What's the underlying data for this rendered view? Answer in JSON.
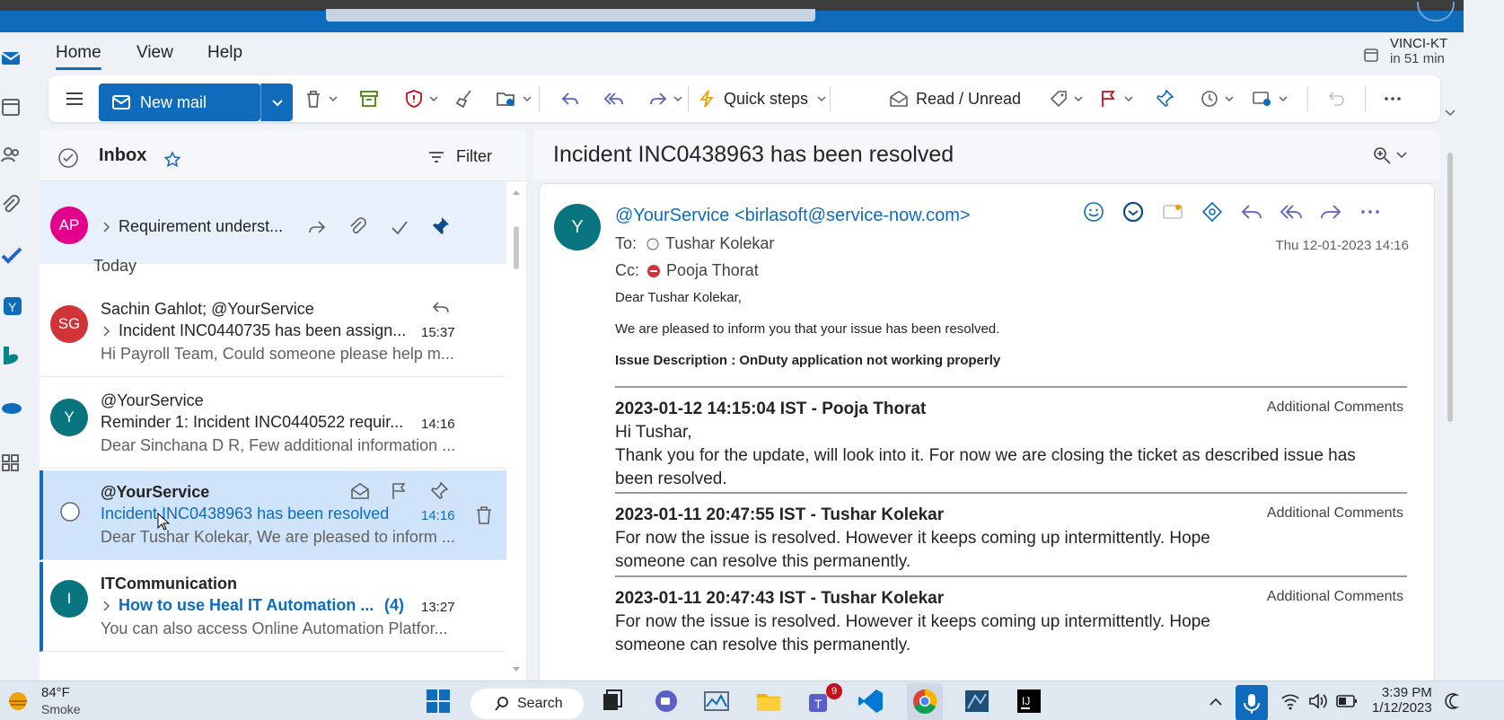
{
  "ribbon": {
    "tabs": [
      "Home",
      "View",
      "Help"
    ],
    "reminder_title": "VINCI-KT",
    "reminder_time": "in 51 min"
  },
  "toolbar": {
    "new_mail": "New mail",
    "quick_steps": "Quick steps",
    "read_unread": "Read / Unread"
  },
  "list": {
    "folder": "Inbox",
    "filter": "Filter",
    "group_today": "Today",
    "pinned": {
      "initials": "AP",
      "subject": "Requirement underst...",
      "avatar_color": "#e3008c"
    },
    "messages": [
      {
        "initials": "SG",
        "sender": "Sachin Gahlot; @YourService",
        "subject": "Incident INC0440735 has been assign...",
        "preview": "Hi Payroll Team, Could someone please help m...",
        "time": "15:37",
        "avatar_color": "#d13438"
      },
      {
        "initials": "Y",
        "sender": "@YourService",
        "subject": "Reminder 1: Incident INC0440522 requir...",
        "preview": "Dear Sinchana D R, Few additional information ...",
        "time": "14:16",
        "avatar_color": "#07747e"
      },
      {
        "initials": "",
        "sender": "@YourService",
        "subject": "Incident INC0438963 has been resolved",
        "preview": "Dear Tushar Kolekar, We are pleased to inform ...",
        "time": "14:16",
        "selected": true
      },
      {
        "initials": "I",
        "sender": "ITCommunication",
        "subject": "How to use Heal IT Automation ...",
        "count": "(4)",
        "preview": "You can also access Online Automation Platfor...",
        "time": "13:27",
        "avatar_color": "#07747e"
      }
    ]
  },
  "reading": {
    "subject": "Incident INC0438963 has been resolved",
    "avatar_initial": "Y",
    "from": "@YourService <birlasoft@service-now.com>",
    "to_label": "To:",
    "to": "Tushar Kolekar",
    "cc_label": "Cc:",
    "cc": "Pooja Thorat",
    "date": "Thu 12-01-2023 14:16",
    "greeting": "Dear Tushar Kolekar,",
    "line1": "We are pleased to inform you that your issue has been resolved.",
    "issue": "Issue Description : OnDuty application not working properly",
    "comments": [
      {
        "head": "2023-01-12 14:15:04 IST - Pooja Thorat",
        "type": "Additional Comments",
        "text": "Hi Tushar,\nThank you for the update, will look into it. For now we are closing the ticket as described issue has been resolved."
      },
      {
        "head": "2023-01-11 20:47:55 IST - Tushar Kolekar",
        "type": "Additional Comments",
        "text": "For now the issue is resolved. However it keeps coming up intermittently. Hope someone can resolve this permanently."
      },
      {
        "head": "2023-01-11 20:47:43 IST - Tushar Kolekar",
        "type": "Additional Comments",
        "text": "For now the issue is resolved. However it keeps coming up intermittently. Hope someone can resolve this permanently."
      }
    ]
  },
  "taskbar": {
    "temperature": "84°F",
    "weather": "Smoke",
    "search": "Search",
    "time": "3:39 PM",
    "date": "1/12/2023",
    "teams_badge": "9"
  },
  "colors": {
    "accent": "#0f6cbd",
    "selected_bg": "#cfe4fa"
  }
}
